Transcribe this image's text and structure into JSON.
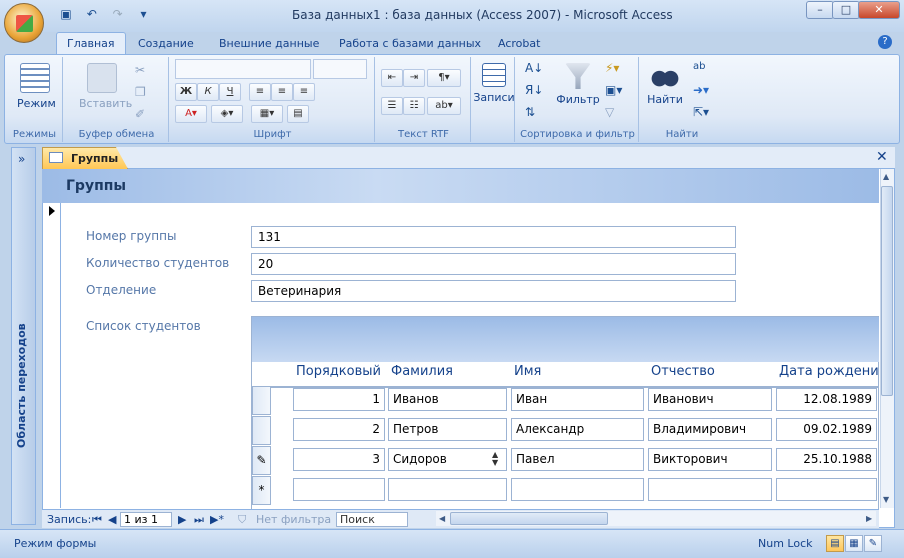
{
  "window": {
    "title": "База данных1 : база данных (Access 2007)  -  Microsoft Access"
  },
  "ribbon": {
    "tabs": [
      "Главная",
      "Создание",
      "Внешние данные",
      "Работа с базами данных",
      "Acrobat"
    ],
    "active_tab": "Главная",
    "groups": {
      "views": {
        "label": "Режимы",
        "button": "Режим"
      },
      "clipboard": {
        "label": "Буфер обмена",
        "button": "Вставить"
      },
      "font": {
        "label": "Шрифт"
      },
      "richtext": {
        "label": "Текст RTF"
      },
      "records": {
        "button": "Записи"
      },
      "sortfilter": {
        "label": "Сортировка и фильтр",
        "button": "Фильтр"
      },
      "find": {
        "label": "Найти",
        "button": "Найти"
      }
    }
  },
  "navpane": {
    "label": "Область переходов"
  },
  "document": {
    "tab_label": "Группы",
    "form_title": "Группы",
    "fields": [
      {
        "label": "Номер группы",
        "value": "131"
      },
      {
        "label": "Количество студентов",
        "value": "20"
      },
      {
        "label": "Отделение",
        "value": "Ветеринария"
      }
    ],
    "subform": {
      "label": "Список студентов",
      "columns": [
        "Порядковый",
        "Фамилия",
        "Имя",
        "Отчество",
        "Дата рождени"
      ],
      "rows": [
        {
          "n": "1",
          "last": "Иванов",
          "first": "Иван",
          "middle": "Иванович",
          "dob": "12.08.1989",
          "marker": ""
        },
        {
          "n": "2",
          "last": "Петров",
          "first": "Александр",
          "middle": "Владимирович",
          "dob": "09.02.1989",
          "marker": ""
        },
        {
          "n": "3",
          "last": "Сидоров",
          "first": "Павел",
          "middle": "Викторович",
          "dob": "25.10.1988",
          "marker": "✎"
        }
      ],
      "new_row_marker": "*"
    }
  },
  "record_nav": {
    "label": "Запись:",
    "position": "1 из 1",
    "filter": "Нет фильтра",
    "search_placeholder": "Поиск"
  },
  "status": {
    "mode": "Режим формы",
    "numlock": "Num Lock"
  }
}
